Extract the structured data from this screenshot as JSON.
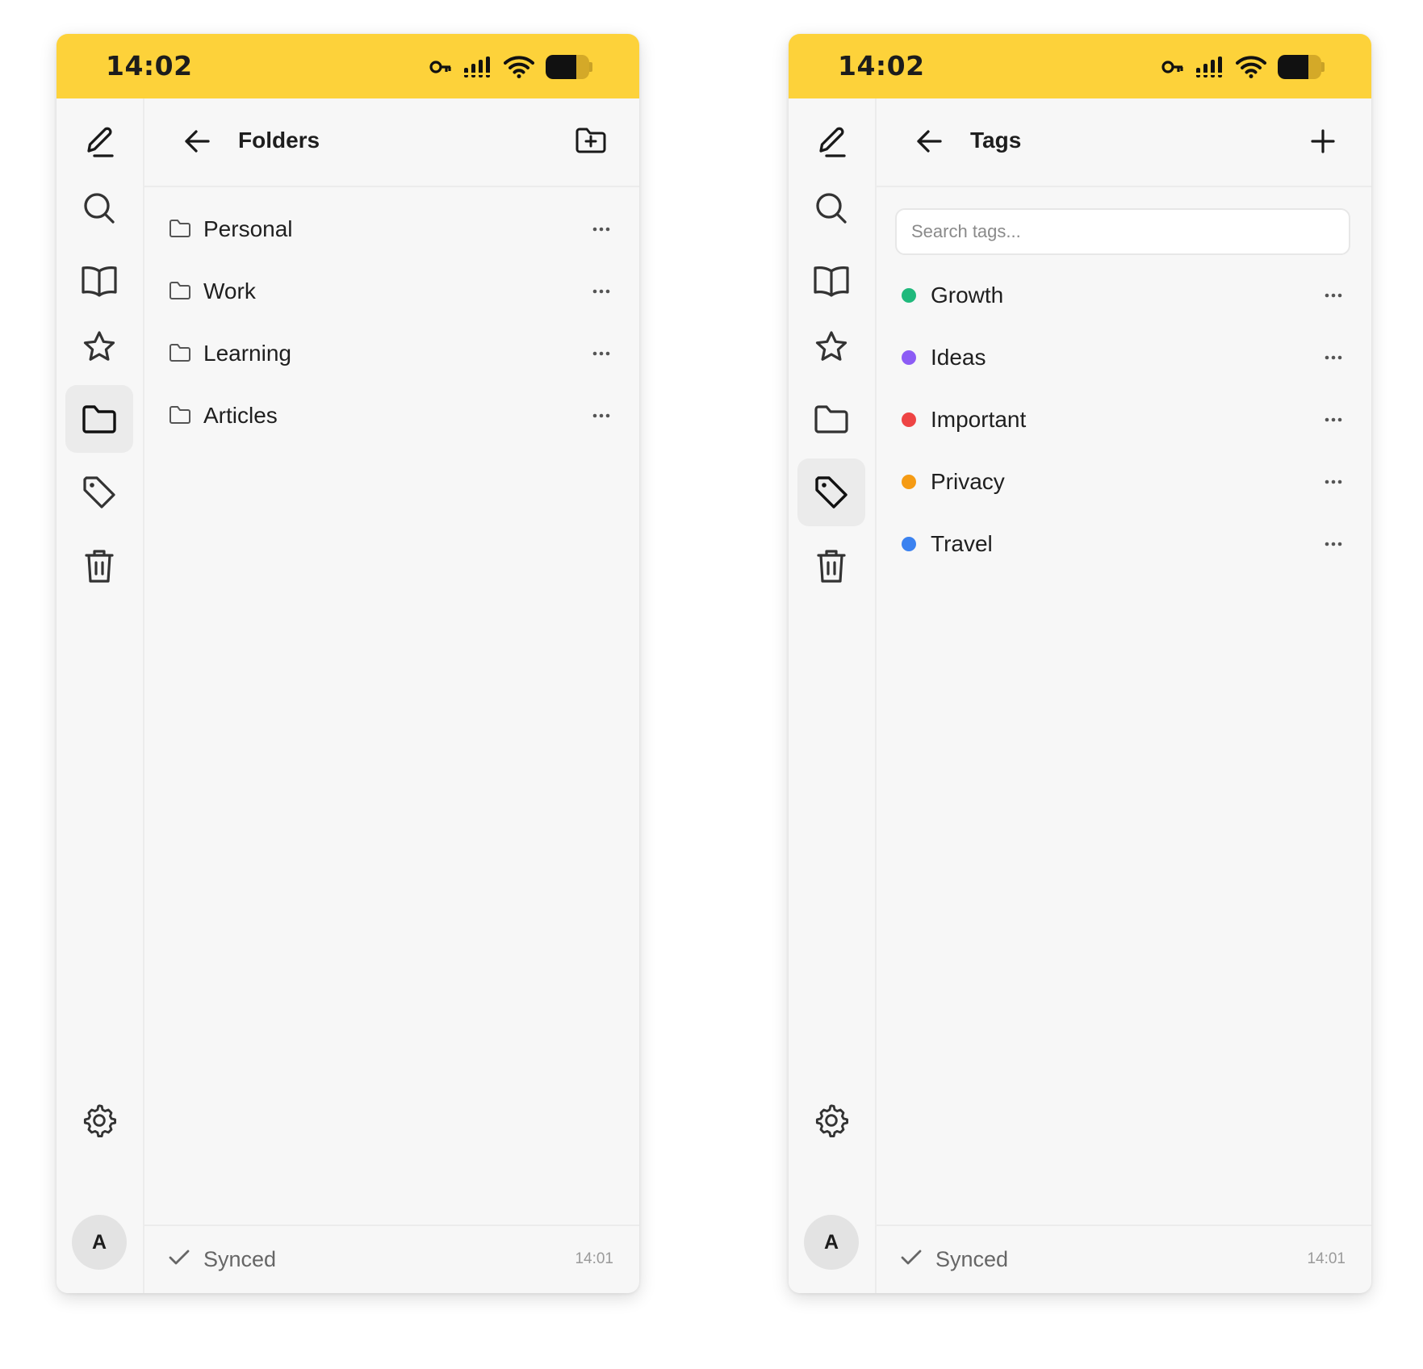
{
  "screens": [
    {
      "status_bar": {
        "time": "14:02"
      },
      "header": {
        "title": "Folders",
        "action": "folder-plus-icon"
      },
      "nav": {
        "active": "folders",
        "avatar_initial": "A"
      },
      "items": [
        {
          "label": "Personal"
        },
        {
          "label": "Work"
        },
        {
          "label": "Learning"
        },
        {
          "label": "Articles"
        }
      ],
      "footer": {
        "sync_status": "Synced",
        "sync_time": "14:01"
      }
    },
    {
      "status_bar": {
        "time": "14:02"
      },
      "header": {
        "title": "Tags",
        "action": "plus-icon"
      },
      "nav": {
        "active": "tags",
        "avatar_initial": "A"
      },
      "search": {
        "placeholder": "Search tags..."
      },
      "items": [
        {
          "label": "Growth",
          "color": "#20b97c"
        },
        {
          "label": "Ideas",
          "color": "#8c5cf5"
        },
        {
          "label": "Important",
          "color": "#ee4444"
        },
        {
          "label": "Privacy",
          "color": "#f59b14"
        },
        {
          "label": "Travel",
          "color": "#3b82f0"
        }
      ],
      "footer": {
        "sync_status": "Synced",
        "sync_time": "14:01"
      }
    }
  ],
  "colors": {
    "status_bar": "#fdd23a",
    "background": "#f7f7f7",
    "active_nav": "#ebebeb"
  }
}
